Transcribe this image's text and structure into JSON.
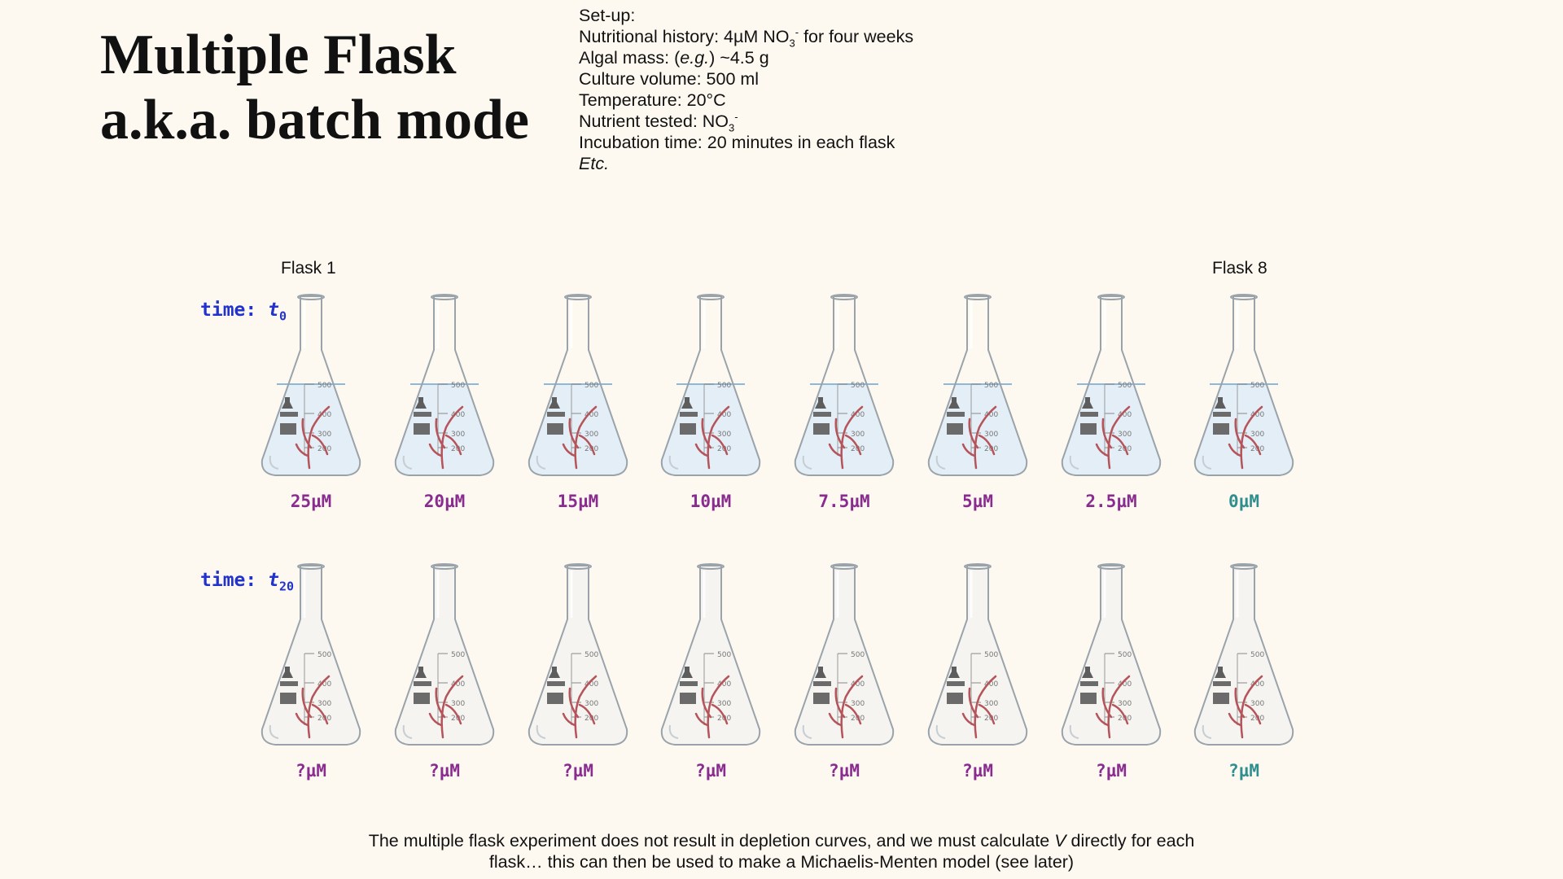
{
  "title": {
    "line1": "Multiple Flask",
    "line2": "a.k.a. batch mode"
  },
  "setup": {
    "heading": "Set-up:",
    "nutritional_prefix": "Nutritional history: 4µM NO",
    "nutritional_sub": "3",
    "nutritional_sup": "-",
    "nutritional_suffix": " for four weeks",
    "algal_prefix": "Algal mass: (",
    "algal_eg": "e.g.",
    "algal_suffix": ") ~4.5 g",
    "culture_volume": "Culture volume: 500 ml",
    "temperature": "Temperature: 20°C",
    "nutrient_prefix": "Nutrient tested: NO",
    "nutrient_sub": "3",
    "nutrient_sup": "-",
    "incubation": "Incubation time: 20 minutes in each flask",
    "etc": "Etc."
  },
  "flask_labels": {
    "first": "Flask 1",
    "last": "Flask 8"
  },
  "rows": {
    "t0": {
      "time_prefix": "time: ",
      "time_t": "t",
      "time_sub": "0",
      "concentrations": [
        "25µM",
        "20µM",
        "15µM",
        "10µM",
        "7.5µM",
        "5µM",
        "2.5µM",
        "0µM"
      ]
    },
    "t20": {
      "time_prefix": "time: ",
      "time_t": "t",
      "time_sub": "20",
      "concentrations": [
        "?µM",
        "?µM",
        "?µM",
        "?µM",
        "?µM",
        "?µM",
        "?µM",
        "?µM"
      ]
    }
  },
  "flask_markings": [
    "500",
    "400",
    "300",
    "200"
  ],
  "colors": {
    "concentration": "#8a2b8f",
    "control": "#2f8f8f",
    "time_label": "#2233cc",
    "seaweed": "#b5545a",
    "water_line": "#8fb7d8"
  },
  "footer": {
    "part1": "The multiple flask experiment does not result in depletion curves, and we must calculate ",
    "v": "V",
    "part2": " directly for each",
    "line2": "flask… this can then be used to make a Michaelis-Menten model (see later)"
  }
}
